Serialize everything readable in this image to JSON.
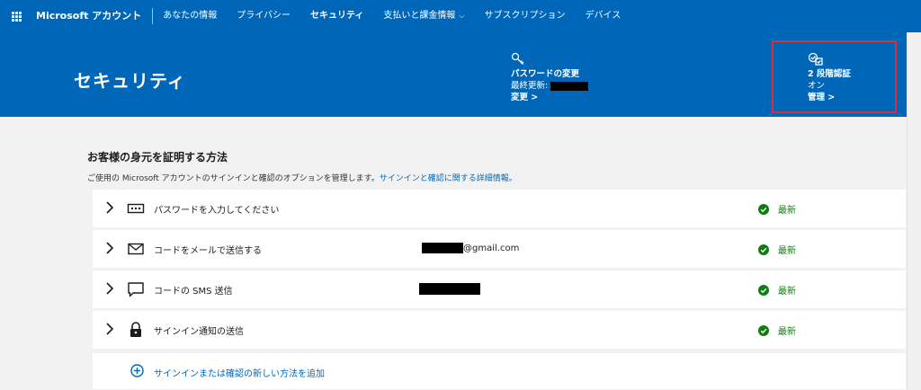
{
  "nav": {
    "brand": "Microsoft アカウント",
    "items": [
      "あなたの情報",
      "プライバシー",
      "セキュリティ",
      "支払いと課金情報",
      "サブスクリプション",
      "デバイス"
    ],
    "active_index": 2,
    "dropdown_chevron": "⌵"
  },
  "hero": {
    "title": "セキュリティ",
    "password_tile": {
      "icon": "key-icon",
      "title": "パスワードの変更",
      "subtitle_prefix": "最終更新:",
      "link": "変更 >"
    },
    "two_factor_tile": {
      "icon": "two-step-check-icon",
      "title": "2 段階認証",
      "status": "オン",
      "link": "管理 >"
    }
  },
  "section": {
    "title": "お客様の身元を証明する方法",
    "desc": "ご使用の Microsoft アカウントのサインインと確認のオプションを管理します。",
    "desc_link": "サインインと確認に関する詳細情報。"
  },
  "methods": [
    {
      "icon": "password-icon",
      "label": "パスワードを入力してください",
      "detail": "",
      "status": "最新"
    },
    {
      "icon": "mail-icon",
      "label": "コードをメールで送信する",
      "detail": "@gmail.com",
      "status": "最新"
    },
    {
      "icon": "sms-icon",
      "label": "コードの SMS 送信",
      "detail": "",
      "status": "最新"
    },
    {
      "icon": "lock-icon",
      "label": "サインイン通知の送信",
      "detail": "",
      "status": "最新"
    }
  ],
  "add_method": {
    "icon": "add-circle-icon",
    "label": "サインインまたは確認の新しい方法を追加"
  },
  "colors": {
    "brand_blue": "#0067b8",
    "status_green": "#107c10",
    "highlight_red": "#d13438"
  }
}
